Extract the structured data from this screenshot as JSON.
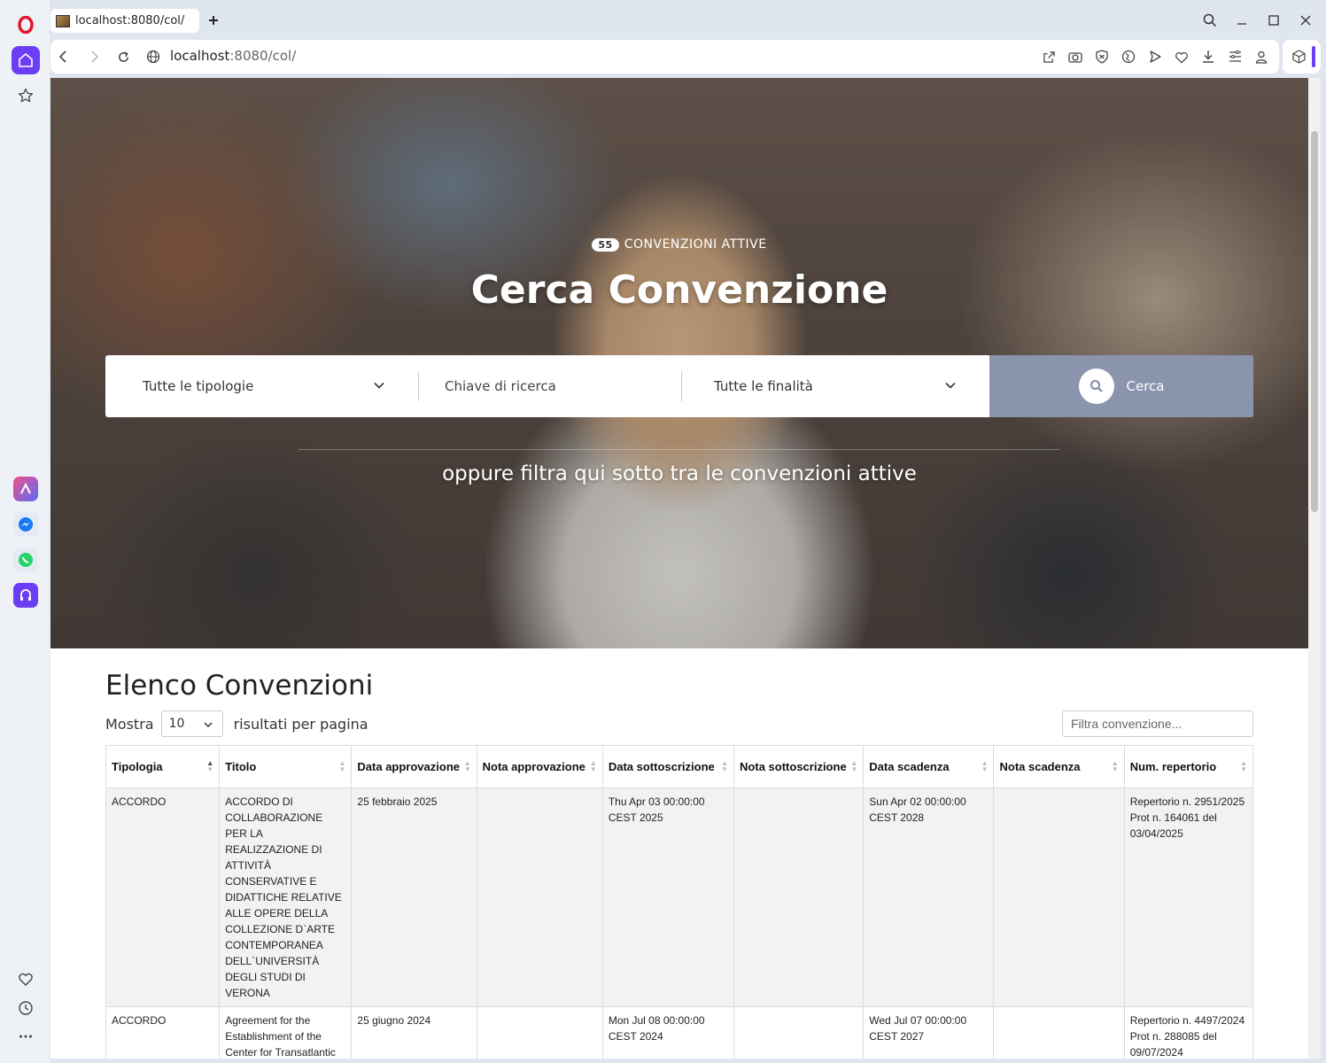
{
  "browser": {
    "tab_title": "localhost:8080/col/",
    "url_host": "localhost",
    "url_rest": ":8080/col/"
  },
  "hero": {
    "badge_count": "55",
    "badge_label": "CONVENZIONI ATTIVE",
    "title": "Cerca Convenzione",
    "search": {
      "type_select": "Tutte le tipologie",
      "keyword_placeholder": "Chiave di ricerca",
      "purpose_select": "Tutte le finalità",
      "button_label": "Cerca"
    },
    "subtitle": "oppure filtra qui sotto tra le convenzioni attive"
  },
  "list": {
    "title": "Elenco Convenzioni",
    "show_label": "Mostra",
    "page_size": "10",
    "per_page_label": "risultati per pagina",
    "filter_placeholder": "Filtra convenzione...",
    "columns": [
      "Tipologia",
      "Titolo",
      "Data approvazione",
      "Nota approvazione",
      "Data sottoscrizione",
      "Nota sottoscrizione",
      "Data scadenza",
      "Nota scadenza",
      "Num. repertorio"
    ],
    "rows": [
      {
        "tipologia": "ACCORDO",
        "titolo": "ACCORDO DI COLLABORAZIONE PER LA REALIZZAZIONE DI ATTIVITÀ CONSERVATIVE E DIDATTICHE RELATIVE ALLE OPERE DELLA COLLEZIONE D`ARTE CONTEMPORANEA DELL`UNIVERSITÀ DEGLI STUDI DI VERONA",
        "data_approvazione": "25 febbraio 2025",
        "nota_approvazione": "",
        "data_sottoscrizione": "Thu Apr 03 00:00:00 CEST 2025",
        "nota_sottoscrizione": "",
        "data_scadenza": "Sun Apr 02 00:00:00 CEST 2028",
        "nota_scadenza": "",
        "num_repertorio": "Repertorio n. 2951/2025 Prot n. 164061 del 03/04/2025"
      },
      {
        "tipologia": "ACCORDO",
        "titolo": "Agreement for the Establishment of the Center for Transatlantic",
        "data_approvazione": "25 giugno 2024",
        "nota_approvazione": "",
        "data_sottoscrizione": "Mon Jul 08 00:00:00 CEST 2024",
        "nota_sottoscrizione": "",
        "data_scadenza": "Wed Jul 07 00:00:00 CEST 2027",
        "nota_scadenza": "",
        "num_repertorio": "Repertorio n. 4497/2024 Prot n. 288085 del 09/07/2024"
      }
    ]
  }
}
